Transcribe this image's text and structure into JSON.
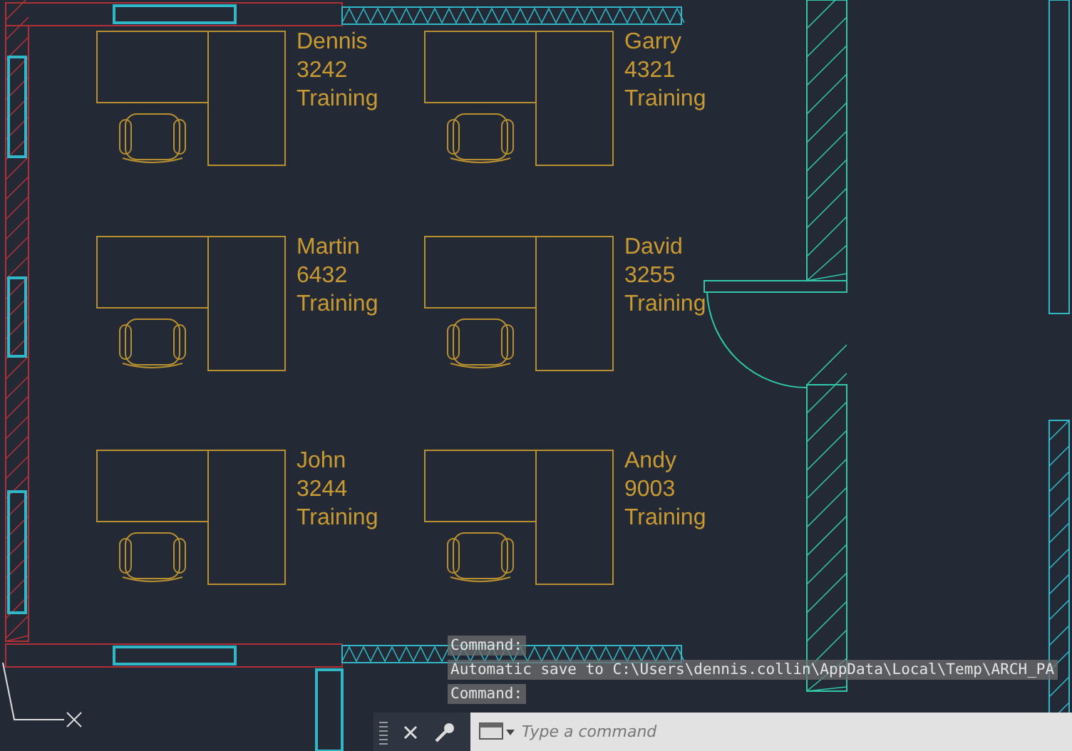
{
  "desks": [
    {
      "name": "Dennis",
      "extension": "3242",
      "department": "Training"
    },
    {
      "name": "Garry",
      "extension": "4321",
      "department": "Training"
    },
    {
      "name": "Martin",
      "extension": "6432",
      "department": "Training"
    },
    {
      "name": "David",
      "extension": "3255",
      "department": "Training"
    },
    {
      "name": "John",
      "extension": "3244",
      "department": "Training"
    },
    {
      "name": "Andy",
      "extension": "9003",
      "department": "Training"
    }
  ],
  "command_history": [
    "Command:",
    "Automatic save to C:\\Users\\dennis.collin\\AppData\\Local\\Temp\\ARCH_PA",
    "Command:"
  ],
  "command_input": {
    "placeholder": "Type a command"
  }
}
